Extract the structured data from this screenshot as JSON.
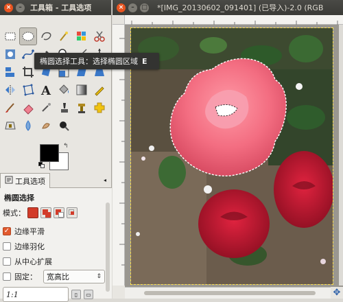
{
  "toolbox": {
    "title": "工具箱 - 工具选项",
    "tools": [
      "rect-select-icon",
      "ellipse-select-icon",
      "lasso-icon",
      "fuzzy-select-icon",
      "select-by-color-icon",
      "scissors-icon",
      "foreground-select-icon",
      "paths-icon",
      "color-picker-icon",
      "zoom-icon",
      "measure-icon",
      "move-icon",
      "align-icon",
      "crop-icon",
      "rotate-icon",
      "scale-icon",
      "shear-icon",
      "perspective-icon",
      "flip-icon",
      "cage-icon",
      "text-icon",
      "bucket-fill-icon",
      "blend-icon",
      "pencil-icon",
      "paintbrush-icon",
      "eraser-icon",
      "airbrush-icon",
      "ink-icon",
      "clone-icon",
      "heal-icon",
      "perspective-clone-icon",
      "blur-icon",
      "smudge-icon",
      "dodge-burn-icon"
    ],
    "active_tool": 1,
    "fg_color": "#000000",
    "bg_color": "#ffffff"
  },
  "tooltip": {
    "text": "椭圆选择工具：选择椭圆区域",
    "shortcut": "E"
  },
  "tabs": {
    "tool_options_label": "工具选项"
  },
  "tool_options": {
    "title": "椭圆选择",
    "mode_label": "模式：",
    "antialias_label": "边缘平滑",
    "antialias_checked": true,
    "feather_label": "边缘羽化",
    "feather_checked": false,
    "expand_center_label": "从中心扩展",
    "expand_center_checked": false,
    "fixed_label": "固定：",
    "fixed_checked": false,
    "fixed_value": "宽高比",
    "ratio_value": "1:1"
  },
  "image_window": {
    "title": "*[IMG_20130602_091401] (已导入)-2.0 (RGB"
  },
  "colors": {
    "accent": "#e95420",
    "checkbox_on": "#e25a2e",
    "selection_outline": "#ffe14a"
  }
}
